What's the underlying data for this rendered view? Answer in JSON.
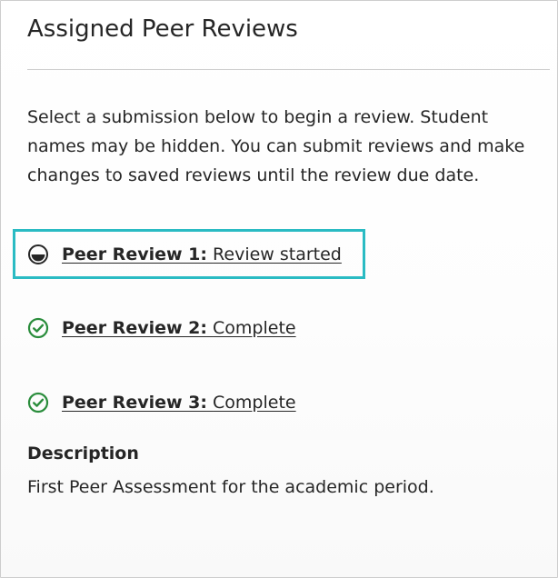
{
  "panel": {
    "title": "Assigned Peer Reviews",
    "instructions": "Select a submission below to begin a review. Student names may be hidden. You can submit reviews and make changes to saved reviews until the review due date."
  },
  "reviews": [
    {
      "name": "Peer Review 1:",
      "status": "Review started",
      "icon": "half-filled-circle-icon",
      "highlighted": true
    },
    {
      "name": "Peer Review 2:",
      "status": "Complete",
      "icon": "check-circle-icon",
      "highlighted": false
    },
    {
      "name": "Peer Review 3:",
      "status": "Complete",
      "icon": "check-circle-icon",
      "highlighted": false
    }
  ],
  "description": {
    "heading": "Description",
    "text": "First Peer Assessment for the academic period."
  },
  "colors": {
    "highlight_border": "#2abbc3",
    "complete_green": "#2a8d3c",
    "text": "#262626",
    "divider": "#cfcfcf"
  }
}
